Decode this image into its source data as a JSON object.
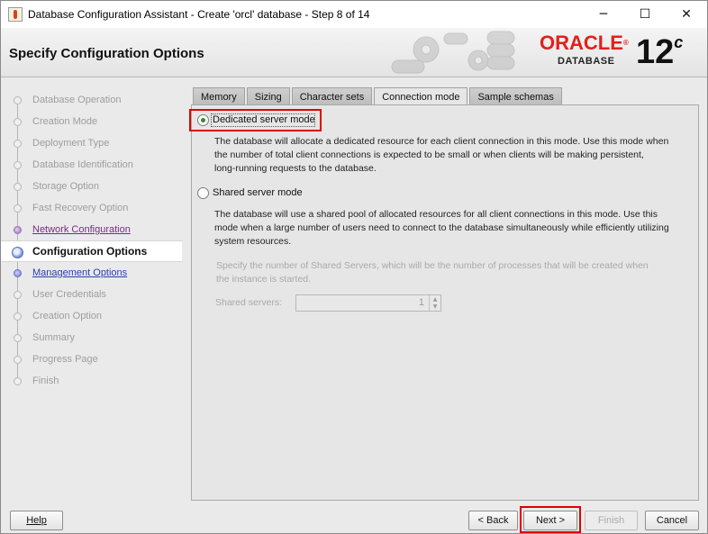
{
  "window": {
    "title": "Database Configuration Assistant - Create 'orcl' database - Step 8 of 14",
    "controls": {
      "minimize": "─",
      "maximize": "☐",
      "close": "✕"
    }
  },
  "header": {
    "title": "Specify Configuration Options",
    "brand_word": "ORACLE",
    "brand_reg": "®",
    "brand_sub": "DATABASE",
    "version": "12",
    "version_suffix": "c"
  },
  "nav": {
    "items": [
      {
        "label": "Database Operation",
        "state": "disabled"
      },
      {
        "label": "Creation Mode",
        "state": "disabled"
      },
      {
        "label": "Deployment Type",
        "state": "disabled"
      },
      {
        "label": "Database Identification",
        "state": "disabled"
      },
      {
        "label": "Storage Option",
        "state": "disabled"
      },
      {
        "label": "Fast Recovery Option",
        "state": "disabled"
      },
      {
        "label": "Network Configuration",
        "state": "visited"
      },
      {
        "label": "Configuration Options",
        "state": "active"
      },
      {
        "label": "Management Options",
        "state": "link"
      },
      {
        "label": "User Credentials",
        "state": "disabled"
      },
      {
        "label": "Creation Option",
        "state": "disabled"
      },
      {
        "label": "Summary",
        "state": "disabled"
      },
      {
        "label": "Progress Page",
        "state": "disabled"
      },
      {
        "label": "Finish",
        "state": "disabled"
      }
    ]
  },
  "tabs": [
    {
      "label": "Memory",
      "active": false
    },
    {
      "label": "Sizing",
      "active": false
    },
    {
      "label": "Character sets",
      "active": false
    },
    {
      "label": "Connection mode",
      "active": true
    },
    {
      "label": "Sample schemas",
      "active": false
    }
  ],
  "connection": {
    "dedicated_label": "Dedicated server mode",
    "dedicated_selected": true,
    "dedicated_desc_1": "The database will allocate a dedicated resource for each client connection in this mode. Use this mode when",
    "dedicated_desc_2": "the number of total client connections is expected to be small or when clients will be making persistent,",
    "dedicated_desc_3": "long-running requests to the database.",
    "shared_label": "Shared server mode",
    "shared_selected": false,
    "shared_desc_1": "The database will use a shared pool of allocated resources for all client connections in this mode.  Use this",
    "shared_desc_2": "mode when a large number of users need to connect to the database simultaneously while efficiently utilizing",
    "shared_desc_3": "system resources.",
    "servers_hint_1": "Specify the number of Shared Servers, which will be the number of processes that will be created when",
    "servers_hint_2": "the instance is started.",
    "servers_label": "Shared servers:",
    "servers_value": "1"
  },
  "buttons": {
    "help": "Help",
    "back": "< Back",
    "next": "Next >",
    "finish": "Finish",
    "cancel": "Cancel"
  },
  "colors": {
    "highlight_red": "#e00000",
    "oracle_red": "#e2201c",
    "link_blue": "#2a3fa8",
    "visited_purple": "#7b2a86"
  }
}
